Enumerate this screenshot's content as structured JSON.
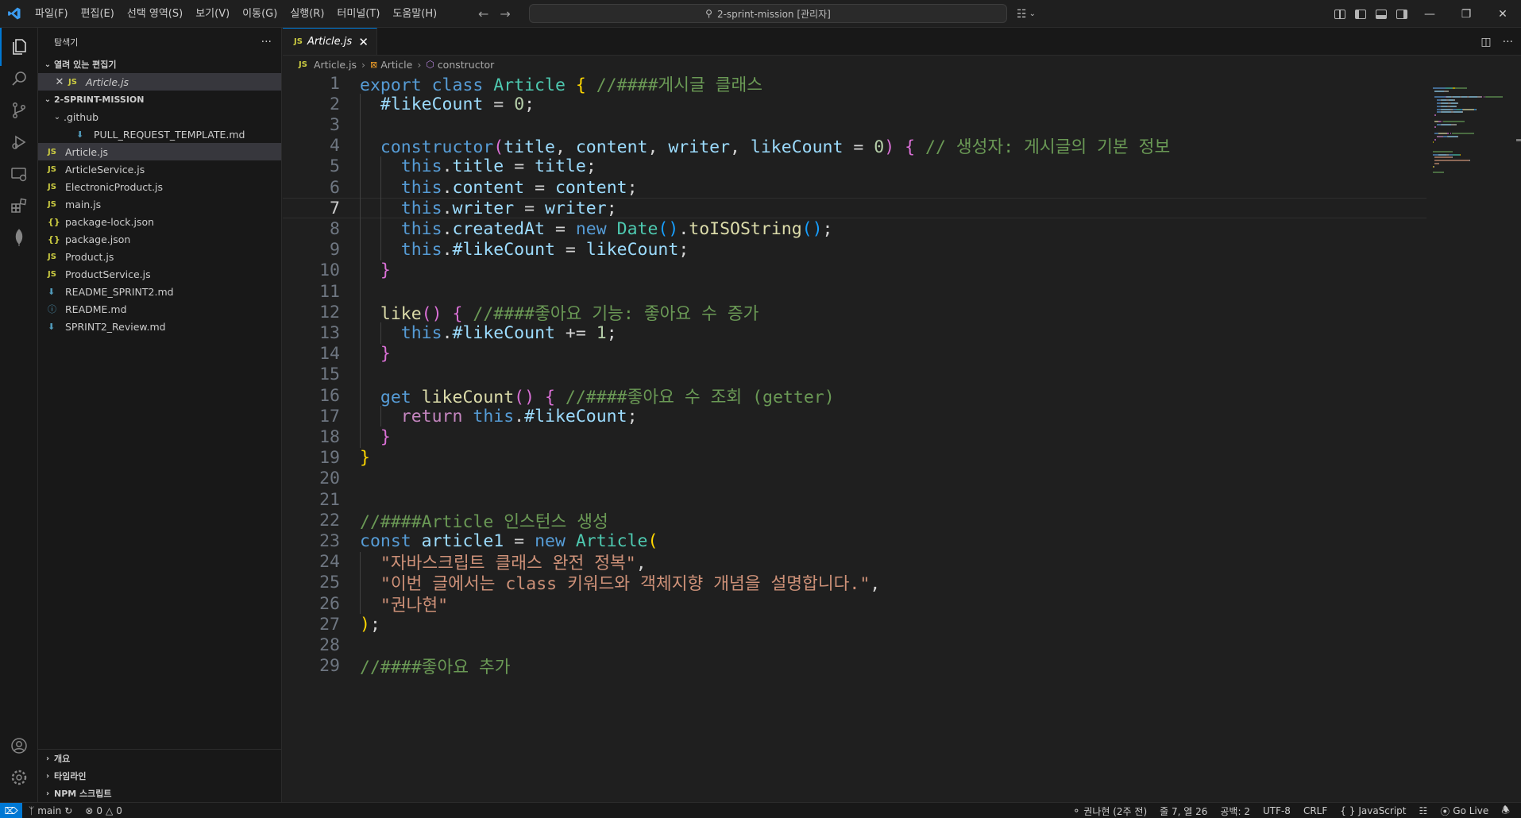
{
  "titlebar": {
    "menu": [
      "파일(F)",
      "편집(E)",
      "선택 영역(S)",
      "보기(V)",
      "이동(G)",
      "실행(R)",
      "터미널(T)",
      "도움말(H)"
    ],
    "search_text": "2-sprint-mission [관리자]"
  },
  "sidebar": {
    "title": "탐색기",
    "more": "···",
    "open_editors": {
      "label": "열려 있는 편집기",
      "items": [
        {
          "icon": "JS",
          "name": "Article.js"
        }
      ]
    },
    "project": {
      "label": "2-SPRINT-MISSION",
      "folders": [
        {
          "name": ".github",
          "children": [
            {
              "icon": "md",
              "name": "PULL_REQUEST_TEMPLATE.md"
            }
          ]
        }
      ],
      "files": [
        {
          "icon": "JS",
          "name": "Article.js"
        },
        {
          "icon": "JS",
          "name": "ArticleService.js"
        },
        {
          "icon": "JS",
          "name": "ElectronicProduct.js"
        },
        {
          "icon": "JS",
          "name": "main.js"
        },
        {
          "icon": "{}",
          "name": "package-lock.json"
        },
        {
          "icon": "{}",
          "name": "package.json"
        },
        {
          "icon": "JS",
          "name": "Product.js"
        },
        {
          "icon": "JS",
          "name": "ProductService.js"
        },
        {
          "icon": "md",
          "name": "README_SPRINT2.md"
        },
        {
          "icon": "i",
          "name": "README.md"
        },
        {
          "icon": "md",
          "name": "SPRINT2_Review.md"
        }
      ]
    },
    "bottom_sections": [
      "개요",
      "타임라인",
      "NPM 스크립트"
    ]
  },
  "editor": {
    "tab": {
      "icon": "JS",
      "label": "Article.js"
    },
    "breadcrumb": [
      "Article.js",
      "Article",
      "constructor"
    ],
    "current_line": 7,
    "lines": [
      {
        "n": "1",
        "t": [
          [
            "kw",
            "export "
          ],
          [
            "kw",
            "class "
          ],
          [
            "cls",
            "Article "
          ],
          [
            "p1",
            "{ "
          ],
          [
            "cm",
            "//####게시글 클래스"
          ]
        ]
      },
      {
        "n": "2",
        "t": [
          [
            "txt",
            "  "
          ],
          [
            "var",
            "#likeCount"
          ],
          [
            "txt",
            " = "
          ],
          [
            "num",
            "0"
          ],
          [
            "txt",
            ";"
          ]
        ]
      },
      {
        "n": "3",
        "t": []
      },
      {
        "n": "4",
        "t": [
          [
            "txt",
            "  "
          ],
          [
            "kw",
            "constructor"
          ],
          [
            "p2",
            "("
          ],
          [
            "var",
            "title"
          ],
          [
            "txt",
            ", "
          ],
          [
            "var",
            "content"
          ],
          [
            "txt",
            ", "
          ],
          [
            "var",
            "writer"
          ],
          [
            "txt",
            ", "
          ],
          [
            "var",
            "likeCount"
          ],
          [
            "txt",
            " = "
          ],
          [
            "num",
            "0"
          ],
          [
            "p2",
            ")"
          ],
          [
            "txt",
            " "
          ],
          [
            "p2",
            "{"
          ],
          [
            "txt",
            " "
          ],
          [
            "cm",
            "// 생성자: 게시글의 기본 정보"
          ]
        ]
      },
      {
        "n": "5",
        "t": [
          [
            "txt",
            "    "
          ],
          [
            "kw",
            "this"
          ],
          [
            "txt",
            "."
          ],
          [
            "var",
            "title"
          ],
          [
            "txt",
            " = "
          ],
          [
            "var",
            "title"
          ],
          [
            "txt",
            ";"
          ]
        ]
      },
      {
        "n": "6",
        "t": [
          [
            "txt",
            "    "
          ],
          [
            "kw",
            "this"
          ],
          [
            "txt",
            "."
          ],
          [
            "var",
            "content"
          ],
          [
            "txt",
            " = "
          ],
          [
            "var",
            "content"
          ],
          [
            "txt",
            ";"
          ]
        ]
      },
      {
        "n": "7",
        "t": [
          [
            "txt",
            "    "
          ],
          [
            "kw",
            "this"
          ],
          [
            "txt",
            "."
          ],
          [
            "var",
            "writer"
          ],
          [
            "txt",
            " = "
          ],
          [
            "var",
            "writer"
          ],
          [
            "txt",
            ";"
          ]
        ]
      },
      {
        "n": "8",
        "t": [
          [
            "txt",
            "    "
          ],
          [
            "kw",
            "this"
          ],
          [
            "txt",
            "."
          ],
          [
            "var",
            "createdAt"
          ],
          [
            "txt",
            " = "
          ],
          [
            "kw",
            "new "
          ],
          [
            "cls",
            "Date"
          ],
          [
            "p3",
            "()"
          ],
          [
            "txt",
            "."
          ],
          [
            "fn",
            "toISOString"
          ],
          [
            "p3",
            "()"
          ],
          [
            "txt",
            ";"
          ]
        ]
      },
      {
        "n": "9",
        "t": [
          [
            "txt",
            "    "
          ],
          [
            "kw",
            "this"
          ],
          [
            "txt",
            "."
          ],
          [
            "var",
            "#likeCount"
          ],
          [
            "txt",
            " = "
          ],
          [
            "var",
            "likeCount"
          ],
          [
            "txt",
            ";"
          ]
        ]
      },
      {
        "n": "10",
        "t": [
          [
            "txt",
            "  "
          ],
          [
            "p2",
            "}"
          ]
        ]
      },
      {
        "n": "11",
        "t": []
      },
      {
        "n": "12",
        "t": [
          [
            "txt",
            "  "
          ],
          [
            "fn",
            "like"
          ],
          [
            "p2",
            "()"
          ],
          [
            "txt",
            " "
          ],
          [
            "p2",
            "{"
          ],
          [
            "txt",
            " "
          ],
          [
            "cm",
            "//####좋아요 기능: 좋아요 수 증가"
          ]
        ]
      },
      {
        "n": "13",
        "t": [
          [
            "txt",
            "    "
          ],
          [
            "kw",
            "this"
          ],
          [
            "txt",
            "."
          ],
          [
            "var",
            "#likeCount"
          ],
          [
            "txt",
            " += "
          ],
          [
            "num",
            "1"
          ],
          [
            "txt",
            ";"
          ]
        ]
      },
      {
        "n": "14",
        "t": [
          [
            "txt",
            "  "
          ],
          [
            "p2",
            "}"
          ]
        ]
      },
      {
        "n": "15",
        "t": []
      },
      {
        "n": "16",
        "t": [
          [
            "txt",
            "  "
          ],
          [
            "kw",
            "get "
          ],
          [
            "fn",
            "likeCount"
          ],
          [
            "p2",
            "()"
          ],
          [
            "txt",
            " "
          ],
          [
            "p2",
            "{"
          ],
          [
            "txt",
            " "
          ],
          [
            "cm",
            "//####좋아요 수 조회 (getter)"
          ]
        ]
      },
      {
        "n": "17",
        "t": [
          [
            "txt",
            "    "
          ],
          [
            "kw2",
            "return "
          ],
          [
            "kw",
            "this"
          ],
          [
            "txt",
            "."
          ],
          [
            "var",
            "#likeCount"
          ],
          [
            "txt",
            ";"
          ]
        ]
      },
      {
        "n": "18",
        "t": [
          [
            "txt",
            "  "
          ],
          [
            "p2",
            "}"
          ]
        ]
      },
      {
        "n": "19",
        "t": [
          [
            "p1",
            "}"
          ]
        ]
      },
      {
        "n": "20",
        "t": []
      },
      {
        "n": "21",
        "t": []
      },
      {
        "n": "22",
        "t": [
          [
            "cm",
            "//####Article 인스턴스 생성"
          ]
        ]
      },
      {
        "n": "23",
        "t": [
          [
            "kw",
            "const "
          ],
          [
            "var",
            "article1"
          ],
          [
            "txt",
            " = "
          ],
          [
            "kw",
            "new "
          ],
          [
            "cls",
            "Article"
          ],
          [
            "p1",
            "("
          ]
        ]
      },
      {
        "n": "24",
        "t": [
          [
            "txt",
            "  "
          ],
          [
            "str",
            "\"자바스크립트 클래스 완전 정복\""
          ],
          [
            "txt",
            ","
          ]
        ]
      },
      {
        "n": "25",
        "t": [
          [
            "txt",
            "  "
          ],
          [
            "str",
            "\"이번 글에서는 class 키워드와 객체지향 개념을 설명합니다.\""
          ],
          [
            "txt",
            ","
          ]
        ]
      },
      {
        "n": "26",
        "t": [
          [
            "txt",
            "  "
          ],
          [
            "str",
            "\"권나현\""
          ]
        ]
      },
      {
        "n": "27",
        "t": [
          [
            "p1",
            ")"
          ],
          [
            "txt",
            ";"
          ]
        ]
      },
      {
        "n": "28",
        "t": []
      },
      {
        "n": "29",
        "t": [
          [
            "cm",
            "//####좋아요 추가"
          ]
        ]
      }
    ]
  },
  "statusbar": {
    "branch": "main",
    "problems": "0",
    "warnings": "0",
    "blame": "권나현 (2주 전)",
    "position": "줄 7, 열 26",
    "spaces": "공백: 2",
    "encoding": "UTF-8",
    "eol": "CRLF",
    "language": "JavaScript",
    "golive": "Go Live"
  }
}
